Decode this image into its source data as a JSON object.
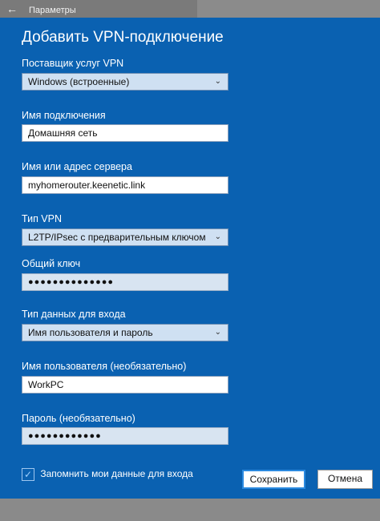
{
  "window": {
    "title": "Параметры",
    "back_icon": "←"
  },
  "dialog": {
    "heading": "Добавить VPN-подключение",
    "fields": [
      {
        "label": "Поставщик услуг VPN",
        "value": "Windows (встроенные)",
        "kind": "select"
      },
      {
        "label": "Имя подключения",
        "value": "Домашняя сеть",
        "kind": "text"
      },
      {
        "label": "Имя или адрес сервера",
        "value": "myhomerouter.keenetic.link",
        "kind": "text"
      },
      {
        "label": "Тип VPN",
        "value": "L2TP/IPsec с предварительным ключом",
        "kind": "select"
      },
      {
        "label": "Общий ключ",
        "value": "●●●●●●●●●●●●●●",
        "kind": "password"
      },
      {
        "label": "Тип данных для входа",
        "value": "Имя пользователя и пароль",
        "kind": "select"
      },
      {
        "label": "Имя пользователя (необязательно)",
        "value": "WorkPC",
        "kind": "text"
      },
      {
        "label": "Пароль (необязательно)",
        "value": "●●●●●●●●●●●●",
        "kind": "password"
      }
    ],
    "remember": {
      "label": "Запомнить мои данные для входа",
      "checked": true
    },
    "buttons": {
      "save": "Сохранить",
      "cancel": "Отмена"
    }
  },
  "colors": {
    "dialog_bg": "#0a61b1",
    "overlay": "#8a8a8a",
    "accent": "#2b8ae0"
  }
}
